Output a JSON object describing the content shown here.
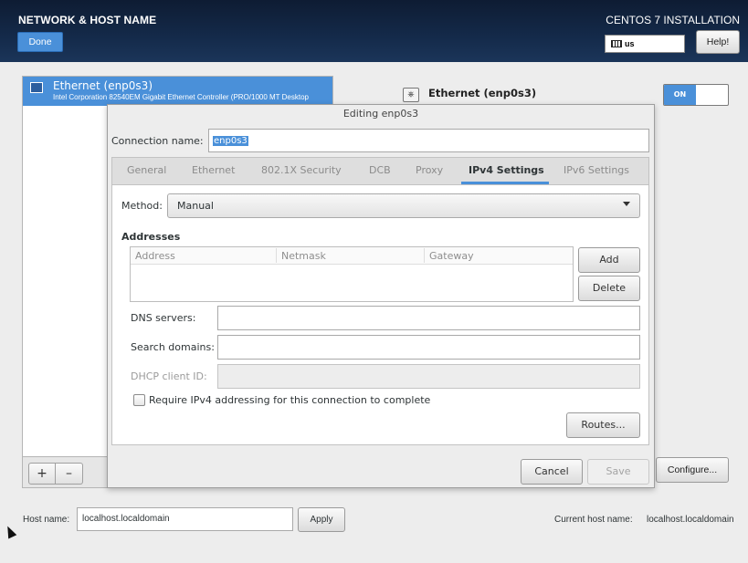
{
  "header": {
    "title": "NETWORK & HOST NAME",
    "done_label": "Done",
    "install_title": "CENTOS 7 INSTALLATION",
    "keyboard_layout": "us",
    "help_label": "Help!"
  },
  "device_list": {
    "items": [
      {
        "name": "Ethernet (enp0s3)",
        "description": "Intel Corporation 82540EM Gigabit Ethernet Controller (PRO/1000 MT Desktop"
      }
    ],
    "add_label": "+",
    "remove_label": "–"
  },
  "device_panel": {
    "name": "Ethernet (enp0s3)",
    "toggle_label": "ON",
    "configure_label": "Configure..."
  },
  "dialog": {
    "title": "Editing enp0s3",
    "connection_name_label": "Connection name:",
    "connection_name_value": "enp0s3",
    "tabs": [
      {
        "label": "General"
      },
      {
        "label": "Ethernet"
      },
      {
        "label": "802.1X Security"
      },
      {
        "label": "DCB"
      },
      {
        "label": "Proxy"
      },
      {
        "label": "IPv4 Settings"
      },
      {
        "label": "IPv6 Settings"
      }
    ],
    "active_tab": "IPv4 Settings",
    "method_label": "Method:",
    "method_value": "Manual",
    "addresses_heading": "Addresses",
    "address_columns": [
      "Address",
      "Netmask",
      "Gateway"
    ],
    "add_label": "Add",
    "delete_label": "Delete",
    "dns_label": "DNS servers:",
    "dns_value": "",
    "search_label": "Search domains:",
    "search_value": "",
    "dhcp_label": "DHCP client ID:",
    "dhcp_value": "",
    "require_label": "Require IPv4 addressing for this connection to complete",
    "require_checked": false,
    "routes_label": "Routes...",
    "cancel_label": "Cancel",
    "save_label": "Save"
  },
  "hostname": {
    "label": "Host name:",
    "value": "localhost.localdomain",
    "apply_label": "Apply",
    "current_label": "Current host name:",
    "current_value": "localhost.localdomain"
  },
  "colors": {
    "accent": "#4a90d9",
    "header_bg": "#142a4a"
  }
}
